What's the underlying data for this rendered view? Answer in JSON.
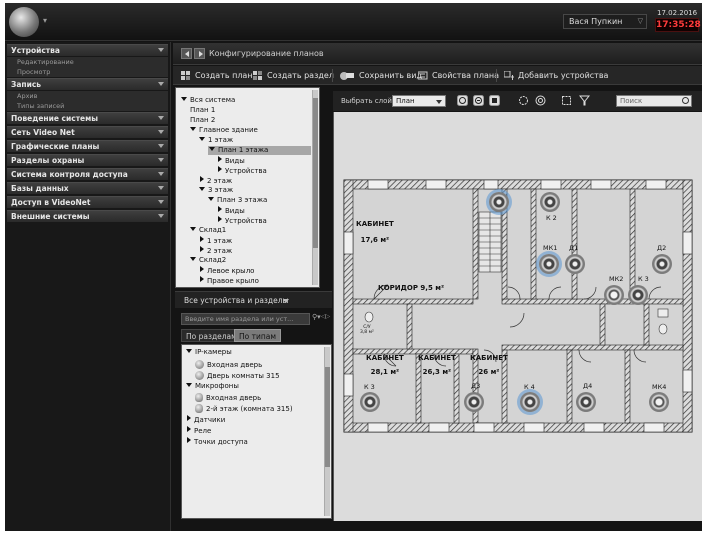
{
  "topbar": {
    "user": "Вася Пупкин",
    "date": "17.02.2016",
    "time": "17:35:28"
  },
  "nav": {
    "sections": [
      {
        "label": "Устройства",
        "items": [
          "Редактирование",
          "Просмотр"
        ]
      },
      {
        "label": "Запись",
        "items": [
          "Архив",
          "Типы записей"
        ]
      },
      {
        "label": "Поведение системы",
        "items": []
      },
      {
        "label": "Сеть Video Net",
        "items": []
      },
      {
        "label": "Графические планы",
        "items": []
      },
      {
        "label": "Разделы охраны",
        "items": []
      },
      {
        "label": "Система контроля доступа",
        "items": []
      },
      {
        "label": "Базы данных",
        "items": []
      },
      {
        "label": "Доступ в VideoNet",
        "items": []
      },
      {
        "label": "Внешние системы",
        "items": []
      }
    ]
  },
  "header": {
    "title": "Конфигурирование планов"
  },
  "toolbar": {
    "create_plan": "Создать план",
    "create_section": "Создать раздел",
    "save_view": "Сохранить вид",
    "plan_props": "Свойства плана",
    "add_devices": "Добавить устройства"
  },
  "tree": [
    {
      "label": "Вся система",
      "level": 0,
      "toggle": "open"
    },
    {
      "label": "План 1",
      "level": 1,
      "toggle": "none"
    },
    {
      "label": "План 2",
      "level": 1,
      "toggle": "none"
    },
    {
      "label": "Главное здание",
      "level": 1,
      "toggle": "open"
    },
    {
      "label": "1 этаж",
      "level": 2,
      "toggle": "open"
    },
    {
      "label": "План 1 этажа",
      "level": 3,
      "toggle": "open",
      "selected": true
    },
    {
      "label": "Виды",
      "level": 4,
      "toggle": "closed"
    },
    {
      "label": "Устройства",
      "level": 4,
      "toggle": "closed"
    },
    {
      "label": "2 этаж",
      "level": 2,
      "toggle": "closed"
    },
    {
      "label": "3 этаж",
      "level": 2,
      "toggle": "open"
    },
    {
      "label": "План 3 этажа",
      "level": 3,
      "toggle": "open"
    },
    {
      "label": "Виды",
      "level": 4,
      "toggle": "closed"
    },
    {
      "label": "Устройства",
      "level": 4,
      "toggle": "closed"
    },
    {
      "label": "Склад1",
      "level": 1,
      "toggle": "open"
    },
    {
      "label": "1 этаж",
      "level": 2,
      "toggle": "closed"
    },
    {
      "label": "2 этаж",
      "level": 2,
      "toggle": "closed"
    },
    {
      "label": "Склад2",
      "level": 1,
      "toggle": "open"
    },
    {
      "label": "Левое крыло",
      "level": 2,
      "toggle": "closed"
    },
    {
      "label": "Правое крыло",
      "level": 2,
      "toggle": "closed"
    }
  ],
  "devices": {
    "title": "Все устройства и разделы",
    "search_placeholder": "Введите имя раздела или уст...",
    "tab_sections": "По разделам",
    "tab_types": "По типам",
    "list": [
      {
        "label": "IP-камеры",
        "level": 0,
        "toggle": "open",
        "icon": "none"
      },
      {
        "label": "Входная дверь",
        "level": 1,
        "toggle": "none",
        "icon": "camera"
      },
      {
        "label": "Дверь комнаты 315",
        "level": 1,
        "toggle": "none",
        "icon": "camera"
      },
      {
        "label": "Микрофоны",
        "level": 0,
        "toggle": "open",
        "icon": "none"
      },
      {
        "label": "Входная дверь",
        "level": 1,
        "toggle": "none",
        "icon": "mic"
      },
      {
        "label": "2-й этаж (комната 315)",
        "level": 1,
        "toggle": "none",
        "icon": "mic"
      },
      {
        "label": "Датчики",
        "level": 0,
        "toggle": "closed",
        "icon": "none"
      },
      {
        "label": "Реле",
        "level": 0,
        "toggle": "closed",
        "icon": "none"
      },
      {
        "label": "Точки доступа",
        "level": 0,
        "toggle": "closed",
        "icon": "none"
      }
    ]
  },
  "planview": {
    "layer_label": "Выбрать слой:",
    "layer_value": "План",
    "search_placeholder": "Поиск",
    "rooms": [
      {
        "name": "КАБИНЕТ",
        "area": "17,6 м²"
      },
      {
        "name": "КОРИДОР  9,5 м²",
        "area": ""
      },
      {
        "name": "КАБИНЕТ",
        "area": "28,1 м²"
      },
      {
        "name": "КАБИНЕТ",
        "area": "26,3 м²"
      },
      {
        "name": "КАБИНЕТ",
        "area": "26 м²"
      }
    ],
    "small_label": "С/У",
    "small_area": "3,8 м²",
    "devices": [
      "К 2",
      "МК1",
      "Д1",
      "Д2",
      "МК2",
      "К 3",
      "К 3",
      "Д3",
      "К 4",
      "Д4",
      "МК4"
    ]
  },
  "colors": {
    "accent": "#4a90d9",
    "clock": "#ff3b3b",
    "background": "#141414",
    "plan": "#dcdcdc"
  }
}
